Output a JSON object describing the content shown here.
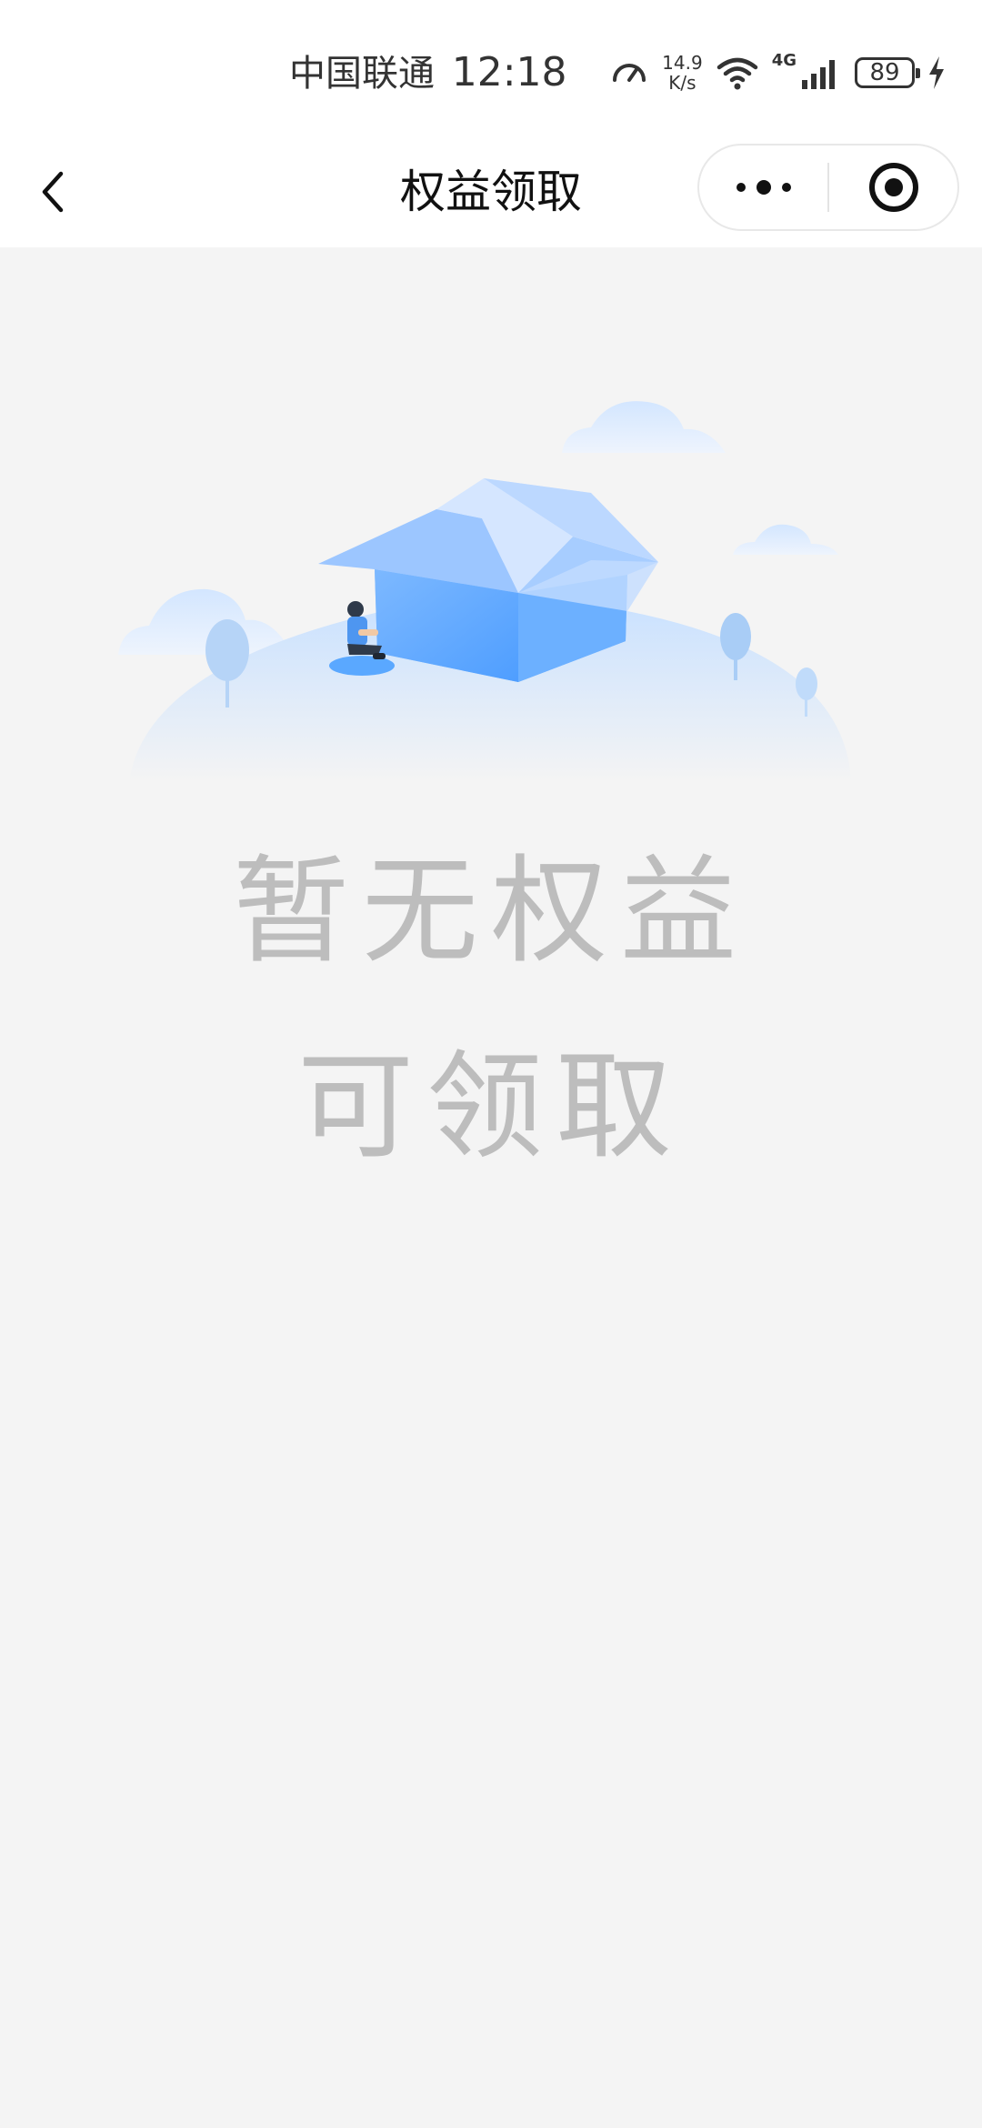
{
  "status_bar": {
    "carrier": "中国联通",
    "time": "12:18",
    "net_speed_value": "14.9",
    "net_speed_unit": "K/s",
    "network_type": "4G",
    "battery": "89"
  },
  "nav": {
    "title": "权益领取"
  },
  "empty_state": {
    "line1": "暂无权益",
    "line2": "可领取"
  },
  "colors": {
    "background": "#f4f4f4",
    "illustration_blue": "#5aa8ff",
    "empty_text": "#bdbdbd"
  }
}
